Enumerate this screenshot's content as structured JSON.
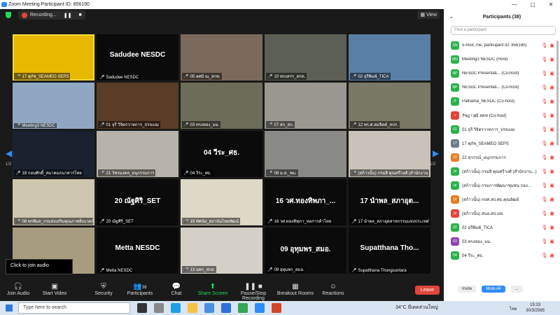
{
  "window": {
    "title": "Zoom Meeting Participant ID: 856190",
    "controls": [
      "—",
      "▢",
      "✕"
    ]
  },
  "topbar": {
    "recording_label": "Recording...",
    "view_label": "View"
  },
  "tiles": [
    {
      "label": "17 ศุภัช_SEAMEO SEPS",
      "type": "video",
      "color": "#e8b800",
      "active": true
    },
    {
      "center": "Sadudee NESDC",
      "label": "Sadudee NESDC",
      "type": "name"
    },
    {
      "label": "05 อศมิ ณ_สกท.",
      "type": "video",
      "color": "#7b6a5c"
    },
    {
      "label": "10 ทรงสรร_สกท.",
      "type": "video",
      "color": "#5b5f55"
    },
    {
      "label": "02 อุรีพิมพ์_TICA",
      "type": "video",
      "color": "#5a7fa6"
    },
    {
      "label": "Meeting3 NESDC",
      "type": "video",
      "color": "#8fa7c2"
    },
    {
      "label": "01 จุรี วิจิตรวาทการ_ปรจงงม",
      "type": "video",
      "color": "#5a3d26"
    },
    {
      "label": "03 ทรงทอง_มม.",
      "type": "video",
      "color": "#6c6c5a"
    },
    {
      "label": "07 สก_สก.",
      "type": "video",
      "color": "#9a9890"
    },
    {
      "label": "12 พร.ศ.สมจิตต์_สปร.",
      "type": "video",
      "color": "#7a7866"
    },
    {
      "label": "18 กอบศักดิ์_สมาคมธนาคารไทย",
      "type": "video",
      "color": "#1a2230"
    },
    {
      "label": "21 วัชรมงคล_อนุกรรมการ",
      "type": "video",
      "color": "#b8b3aa"
    },
    {
      "center": "04 วีระ_ศธ.",
      "label": "04 วีระ_ศธ.",
      "type": "name"
    },
    {
      "label": "06 ม.ส._พม.",
      "type": "video",
      "color": "#8a8a86"
    },
    {
      "label": "(สก้าวนั้น) กรมสิ คุณศรีวงศ์ (สำนักงาน กศน.)",
      "type": "video",
      "color": "#c9c2b8"
    },
    {
      "label": "08 พรพิมล_กรมส่งเสริมคุณภาพสิ่งแวดล้อม",
      "type": "video",
      "color": "#cfc6b0"
    },
    {
      "center": "20 ณัฐศิริ_SET",
      "label": "20 ณัฐศิริ_SET",
      "type": "name"
    },
    {
      "label": "19 ทัศนัย_สถาบันไทยพัฒน์",
      "type": "video",
      "color": "#ded8c8"
    },
    {
      "center": "16 วศ.ทองทิพภา_...",
      "label": "16 วศ.ทองทิพภา_หอการค้าไทย",
      "type": "name"
    },
    {
      "center": "17 นำพล_สภาอุต...",
      "label": "17 นำพล_สภาอุตสาหกรรมแห่งประเทศไทย",
      "type": "name"
    },
    {
      "label": "",
      "type": "video",
      "color": "#a89c80"
    },
    {
      "center": "Metta NESDC",
      "label": "Metta NESDC",
      "type": "name"
    },
    {
      "label": "13 นพร_สกส.",
      "type": "video",
      "color": "#d4d0c8"
    },
    {
      "center": "09 อุทุมพร_สมอ.",
      "label": "09 อุทุมพร_สมอ.",
      "type": "name"
    },
    {
      "center": "Supatthana  Tho...",
      "label": "Supatthana Thongsuntara",
      "type": "name"
    }
  ],
  "pager": {
    "left": "1/2",
    "right": "1/2"
  },
  "tooltip": "Click to join audio",
  "toolbar": {
    "join_audio": "Join Audio",
    "start_video": "Start Video",
    "security": "Security",
    "participants": "Participants",
    "participants_count": "38",
    "chat": "Chat",
    "share_screen": "Share Screen",
    "record": "Pause/Stop Recording",
    "breakout": "Breakout Rooms",
    "reactions": "Reactions",
    "leave": "Leave"
  },
  "panel": {
    "title": "Participants (38)",
    "search_placeholder": "Find a participant",
    "participants": [
      {
        "initials": "SN",
        "name": "o-host, me, participant ID: 856190)",
        "color": "#2bb14b"
      },
      {
        "initials": "MN",
        "name": "Meeting3 NESDC (Host)",
        "color": "#2bb14b"
      },
      {
        "initials": "NP",
        "name": "NESDC Presentati... (Co-host)",
        "color": "#2bb14b"
      },
      {
        "initials": "NP",
        "name": "NESDC Presentati... (Co-host)",
        "color": "#2bb14b"
      },
      {
        "initials": "P",
        "name": "Pathama_NESDC (Co-host)",
        "color": "#2bb14b"
      },
      {
        "initials": "ร",
        "name": "รัชฎาวุฒิ สคช (Co-host)",
        "color": "#e0443b"
      },
      {
        "initials": "01",
        "name": "01 จุรี วิจิตรวาทการ_ปรจงงม",
        "color": "#2bb14b"
      },
      {
        "initials": "17",
        "name": "17 ศุภัช_SEAMEO SEPS",
        "color": "#6c7a89"
      },
      {
        "initials": "22",
        "name": "22 สุวรรณ์_อนุกรรมการ",
        "color": "#e67e22"
      },
      {
        "initials": "(ส",
        "name": "(สก้าวนั้น) กรมสิ คุณศรีวงศ์ (สำนักงาน...)",
        "color": "#2bb14b"
      },
      {
        "initials": "(ส",
        "name": "(สก้าวนั้น) กรมการพัฒนาชุมชน กอง...",
        "color": "#2bb14b"
      },
      {
        "initials": "(ส",
        "name": "(สก้าวนั้น) กปศ.สป.ศธ.คุณอัฒย์",
        "color": "#e67e22"
      },
      {
        "initials": "(ส",
        "name": "(สก้าวนั้น) สนอ.สป.มท.",
        "color": "#e0443b"
      },
      {
        "initials": "02",
        "name": "02 อุรีพิมพ์_TICA",
        "color": "#2bb14b"
      },
      {
        "initials": "03",
        "name": "03 ทรงทอง_มม.",
        "color": "#8e44ad"
      },
      {
        "initials": "04",
        "name": "04 วีระ_ศธ.",
        "color": "#2bb14b"
      }
    ],
    "invite": "Invite",
    "mute_all": "Mute All",
    "more": "..."
  },
  "taskbar": {
    "search_placeholder": "Type here to search",
    "weather": "34°C  มีเดดส่วนใหญ่",
    "lang": "ไทย",
    "time": "15:33",
    "date": "30/3/2565"
  },
  "colors": {
    "accent": "#2d8cff",
    "leave": "#e0443b",
    "active_speaker": "#f5d93b"
  }
}
